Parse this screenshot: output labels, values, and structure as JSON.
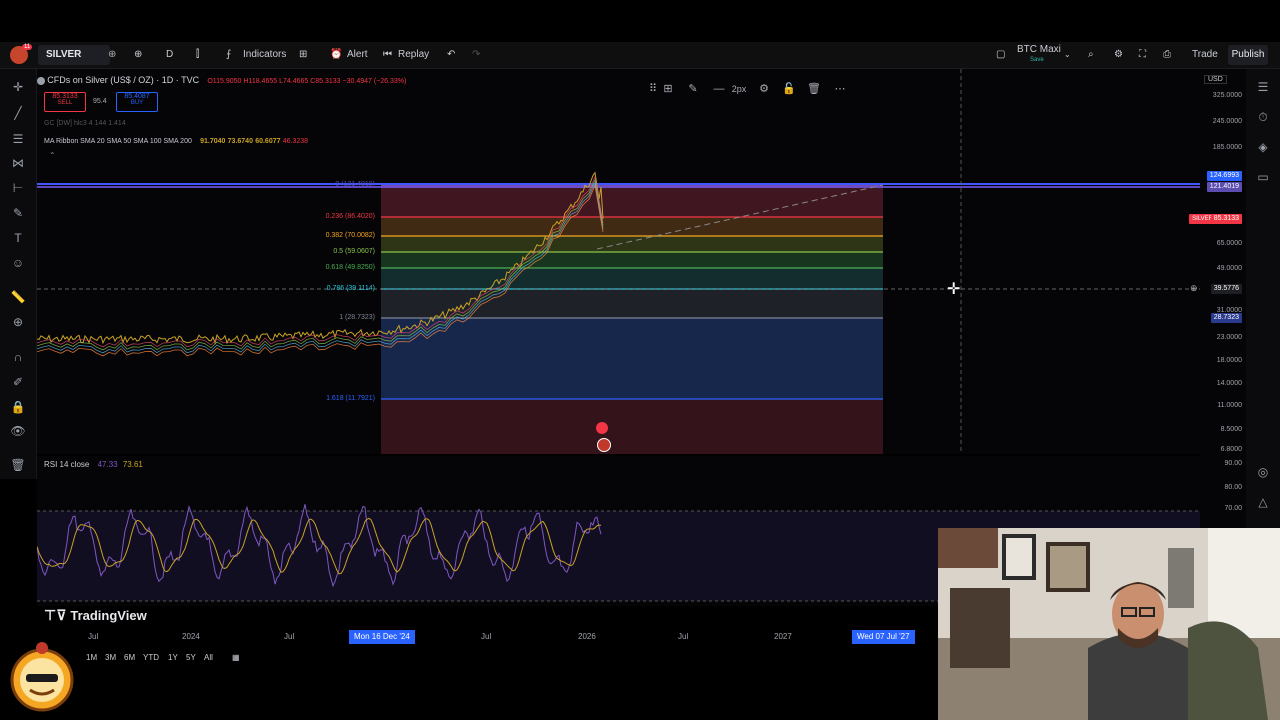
{
  "topbar": {
    "symbol": "SILVER",
    "interval": "D",
    "indicators_label": "Indicators",
    "alert_label": "Alert",
    "replay_label": "Replay",
    "layout_name": "BTC Maxi",
    "layout_sub": "Save",
    "trade_label": "Trade",
    "publish_label": "Publish",
    "notif_count": "11"
  },
  "chart": {
    "title": "CFDs on Silver (US$ / OZ) · 1D · TVC",
    "ohlc": "O115.9050 H118.4655 L74.4665 C85.3133 −30.4947 (−26.33%)",
    "sell_price": "85.3133",
    "sell_label": "SELL",
    "spread": "95.4",
    "buy_price": "85.4087",
    "buy_label": "BUY",
    "secondary_legend": "GC [DW] hlc3 4 144 1.414",
    "ma_legend_name": "MA Ribbon SMA 20 SMA 50 SMA 100 SMA 200",
    "ma_values": [
      "91.7040",
      "73.6740",
      "60.6077",
      "46.3238"
    ],
    "currency": "USD"
  },
  "fib_levels": [
    {
      "label": "0 (121.4019)",
      "color": "#8c6cff"
    },
    {
      "label": "0.236 (86.4020)",
      "color": "#f23645"
    },
    {
      "label": "0.382 (70.0082)",
      "color": "#f5a623"
    },
    {
      "label": "0.5 (59.0607)",
      "color": "#8bc34a"
    },
    {
      "label": "0.618 (49.8250)",
      "color": "#4caf50"
    },
    {
      "label": "0.786 (39.1114)",
      "color": "#26c6da"
    },
    {
      "label": "1 (28.7323)",
      "color": "#7e8795"
    },
    {
      "label": "1.618 (11.7921)",
      "color": "#2962ff"
    }
  ],
  "price_scale": {
    "ticks": [
      "325.0000",
      "245.0000",
      "185.0000",
      "65.0000",
      "49.0000",
      "31.0000",
      "23.0000",
      "18.0000",
      "14.0000",
      "11.0000",
      "8.5000",
      "6.8000"
    ],
    "labels": {
      "upper_a": "124.6993",
      "upper_b": "121.4019",
      "silver_tag": "SILVER",
      "silver_price": "85.3133",
      "crosshair": "39.5776",
      "fib_one": "28.7323"
    },
    "rsi_ticks": [
      "90.00",
      "80.00",
      "70.00"
    ]
  },
  "rsi": {
    "label": "RSI 14 close",
    "values": [
      "47.33",
      "73.61"
    ]
  },
  "xaxis": {
    "labels": [
      "Jul",
      "2024",
      "Jul",
      "Jul",
      "2026",
      "Jul",
      "2027"
    ],
    "cursor_start": "Mon 16 Dec '24",
    "cursor_end": "Wed 07 Jul '27"
  },
  "ranges": [
    "1M",
    "3M",
    "6M",
    "YTD",
    "1Y",
    "5Y",
    "All"
  ],
  "branding": "TradingView",
  "float_toolbar": {
    "width_label": "2px"
  },
  "colors": {
    "accent": "#2962ff",
    "sell": "#f23645",
    "ma": "#c9a227"
  }
}
